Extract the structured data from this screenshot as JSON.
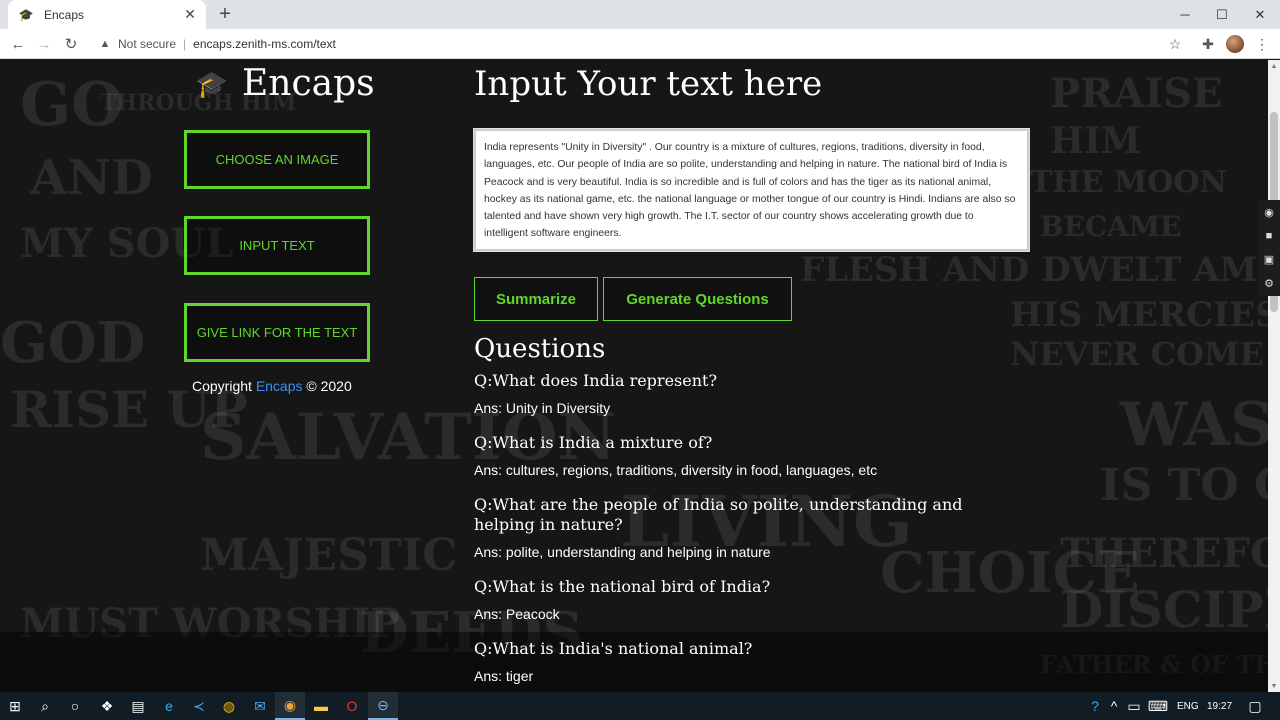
{
  "browser": {
    "tab_title": "Encaps",
    "new_tab_icon": "+",
    "url_prefix": "Not secure",
    "url": "encaps.zenith-ms.com/text"
  },
  "sidebar": {
    "brand": "Encaps",
    "buttons": [
      {
        "label": "CHOOSE AN IMAGE"
      },
      {
        "label": "INPUT TEXT"
      },
      {
        "label": "GIVE LINK FOR THE TEXT"
      }
    ],
    "copyright_prefix": "Copyright",
    "copyright_brand": "Encaps",
    "copyright_suffix": "© 2020"
  },
  "main": {
    "title": "Input Your text here",
    "input_text": "India represents \"Unity in Diversity\" . Our country is a mixture of cultures, regions, traditions, diversity in food, languages, etc. Our people of India are so polite, understanding and helping in nature. The national bird of India is Peacock and is very beautiful. India is so incredible and is full of colors and has the tiger as its national animal, hockey as its national game, etc. the national language or mother tongue of our country is Hindi. Indians are also so talented and have shown very high growth. The I.T. sector of our country shows accelerating growth due to intelligent software engineers.",
    "summarize_label": "Summarize",
    "generate_label": "Generate Questions",
    "questions_heading": "Questions",
    "questions": [
      {
        "q": "Q:What does India represent?",
        "a": "Ans: Unity in Diversity"
      },
      {
        "q": "Q:What is India a mixture of?",
        "a": "Ans: cultures, regions, traditions, diversity in food, languages, etc"
      },
      {
        "q": "Q:What are the people of India so polite, understanding and helping in nature?",
        "a": "Ans: polite, understanding and helping in nature"
      },
      {
        "q": "Q:What is the national bird of India?",
        "a": "Ans: Peacock"
      },
      {
        "q": "Q:What is India's national animal?",
        "a": "Ans: tiger"
      }
    ]
  },
  "taskbar": {
    "lang": "ENG",
    "time": "19:27"
  },
  "colors": {
    "accent_green": "#61d62a",
    "brand_blue": "#3a8dff"
  }
}
